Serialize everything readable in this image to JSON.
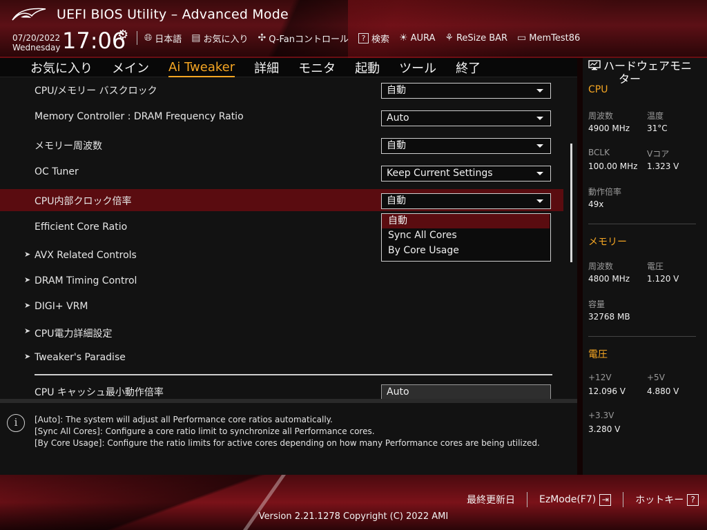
{
  "header": {
    "title": "UEFI BIOS Utility – Advanced Mode",
    "date": "07/20/2022",
    "weekday": "Wednesday",
    "time": "17:06",
    "toolbar": [
      {
        "icon": "globe-icon",
        "label": "日本語"
      },
      {
        "icon": "favorites-icon",
        "label": "お気に入り"
      },
      {
        "icon": "fan-icon",
        "label": "Q-Fanコントロール"
      },
      {
        "icon": "question-icon",
        "label": "検索"
      },
      {
        "icon": "aura-icon",
        "label": "AURA"
      },
      {
        "icon": "resize-bar-icon",
        "label": "ReSize BAR"
      },
      {
        "icon": "memtest-icon",
        "label": "MemTest86"
      }
    ]
  },
  "tabs": [
    "お気に入り",
    "メイン",
    "Ai Tweaker",
    "詳細",
    "モニタ",
    "起動",
    "ツール",
    "終了"
  ],
  "active_tab": "Ai Tweaker",
  "settings": [
    {
      "label": "CPU/メモリー バスクロック",
      "value": "自動"
    },
    {
      "label": "Memory Controller : DRAM Frequency Ratio",
      "value": "Auto"
    },
    {
      "label": "メモリー周波数",
      "value": "自動"
    },
    {
      "label": "OC Tuner",
      "value": "Keep Current Settings"
    },
    {
      "label": "CPU内部クロック倍率",
      "value": "自動"
    },
    {
      "label": "Efficient Core Ratio"
    }
  ],
  "submenus": [
    "AVX Related Controls",
    "DRAM Timing Control",
    "DIGI+ VRM",
    "CPU電力詳細設定",
    "Tweaker's Paradise"
  ],
  "last_setting": {
    "label": "CPU キャッシュ最小動作倍率",
    "value": "Auto"
  },
  "dropdown": {
    "options": [
      "自動",
      "Sync All Cores",
      "By Core Usage"
    ],
    "highlighted": "自動"
  },
  "help": {
    "lines": [
      "[Auto]: The system will adjust all Performance core ratios automatically.",
      "[Sync All Cores]: Configure a core ratio limit to synchronize all Performance cores.",
      "[By Core Usage]: Configure the ratio limits for active cores depending on how many Performance cores are being utilized."
    ]
  },
  "monitor": {
    "title_line1": "ハードウェアモニ",
    "title_line2": "ター",
    "cpu": {
      "section": "CPU",
      "freq_label": "周波数",
      "freq_value": "4900 MHz",
      "temp_label": "温度",
      "temp_value": "31°C",
      "bclk_label": "BCLK",
      "bclk_value": "100.00 MHz",
      "vcore_label": "Vコア",
      "vcore_value": "1.323 V",
      "ratio_label": "動作倍率",
      "ratio_value": "49x"
    },
    "memory": {
      "section": "メモリー",
      "freq_label": "周波数",
      "freq_value": "4800 MHz",
      "volt_label": "電圧",
      "volt_value": "1.120 V",
      "cap_label": "容量",
      "cap_value": "32768 MB"
    },
    "voltage": {
      "section": "電圧",
      "v12_label": "+12V",
      "v12_value": "12.096 V",
      "v5_label": "+5V",
      "v5_value": "4.880 V",
      "v33_label": "+3.3V",
      "v33_value": "3.280 V"
    }
  },
  "footer": {
    "last_modified": "最終更新日",
    "ezmode": "EzMode(F7)",
    "hotkeys": "ホットキー",
    "hotkeys_key": "?",
    "version": "Version 2.21.1278 Copyright (C) 2022 AMI"
  },
  "colors": {
    "accent": "#f5a623",
    "selection": "#5a0c10",
    "brand_red": "#7a1219"
  }
}
